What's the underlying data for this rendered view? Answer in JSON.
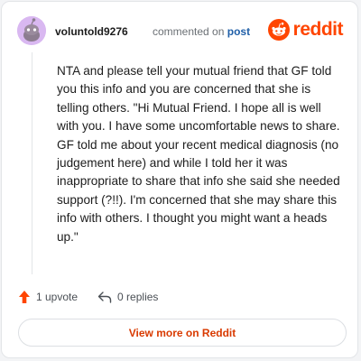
{
  "header": {
    "username": "voluntold9276",
    "meta_text": "commented on",
    "post_link": "post",
    "brand_name": "reddit"
  },
  "comment": {
    "text": "NTA and please tell your mutual friend that GF told you this info and you are concerned that she is telling others. \"Hi Mutual Friend. I hope all is well with you. I have some uncomfortable news to share. GF told me about your recent medical diagnosis (no judgement here) and while I told her it was inappropriate to share that info she said she needed support (?!!). I'm concerned that she may share this info with others. I thought you might want a heads up.\""
  },
  "actions": {
    "upvote_label": "1 upvote",
    "replies_label": "0 replies"
  },
  "footer": {
    "view_more_label": "View more on Reddit"
  },
  "colors": {
    "brand": "#ff4500",
    "upvote": "#ff4500",
    "avatar_bg": "#d9b8f1",
    "link": "#1f5fa8"
  },
  "icons": {
    "avatar": "snoo-avatar-icon",
    "brand": "reddit-logo-icon",
    "upvote": "upvote-arrow-icon",
    "reply": "reply-arrow-icon"
  }
}
